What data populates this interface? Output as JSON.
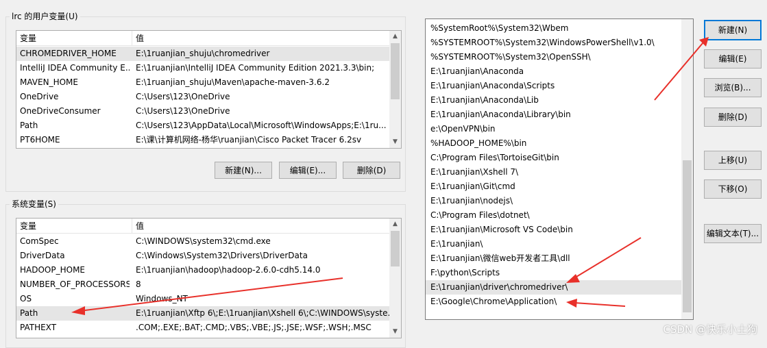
{
  "user_vars": {
    "title": "lrc 的用户变量(U)",
    "columns": [
      "变量",
      "值"
    ],
    "rows": [
      {
        "name": "CHROMEDRIVER_HOME",
        "value": "E:\\1ruanjian_shuju\\chromedriver"
      },
      {
        "name": "IntelliJ IDEA Community E...",
        "value": "E:\\1ruanjian\\IntelliJ IDEA Community Edition 2021.3.3\\bin;"
      },
      {
        "name": "MAVEN_HOME",
        "value": "E:\\1ruanjian_shuju\\Maven\\apache-maven-3.6.2"
      },
      {
        "name": "OneDrive",
        "value": "C:\\Users\\123\\OneDrive"
      },
      {
        "name": "OneDriveConsumer",
        "value": "C:\\Users\\123\\OneDrive"
      },
      {
        "name": "Path",
        "value": "C:\\Users\\123\\AppData\\Local\\Microsoft\\WindowsApps;E:\\1ru..."
      },
      {
        "name": "PT6HOME",
        "value": "E:\\课\\计算机网络-杨华\\ruanjian\\Cisco Packet Tracer 6.2sv"
      }
    ],
    "buttons": {
      "new": "新建(N)...",
      "edit": "编辑(E)...",
      "delete": "删除(D)"
    }
  },
  "system_vars": {
    "title": "系统变量(S)",
    "columns": [
      "变量",
      "值"
    ],
    "rows": [
      {
        "name": "ComSpec",
        "value": "C:\\WINDOWS\\system32\\cmd.exe"
      },
      {
        "name": "DriverData",
        "value": "C:\\Windows\\System32\\Drivers\\DriverData"
      },
      {
        "name": "HADOOP_HOME",
        "value": "E:\\1ruanjian\\hadoop\\hadoop-2.6.0-cdh5.14.0"
      },
      {
        "name": "NUMBER_OF_PROCESSORS",
        "value": "8"
      },
      {
        "name": "OS",
        "value": "Windows_NT"
      },
      {
        "name": "Path",
        "value": "E:\\1ruanjian\\Xftp 6\\;E:\\1ruanjian\\Xshell 6\\;C:\\WINDOWS\\syste..."
      },
      {
        "name": "PATHEXT",
        "value": ".COM;.EXE;.BAT;.CMD;.VBS;.VBE;.JS;.JSE;.WSF;.WSH;.MSC"
      }
    ]
  },
  "path_editor": {
    "entries": [
      "%SystemRoot%\\System32\\Wbem",
      "%SYSTEMROOT%\\System32\\WindowsPowerShell\\v1.0\\",
      "%SYSTEMROOT%\\System32\\OpenSSH\\",
      "E:\\1ruanjian\\Anaconda",
      "E:\\1ruanjian\\Anaconda\\Scripts",
      "E:\\1ruanjian\\Anaconda\\Lib",
      "E:\\1ruanjian\\Anaconda\\Library\\bin",
      "e:\\OpenVPN\\bin",
      "%HADOOP_HOME%\\bin",
      "C:\\Program Files\\TortoiseGit\\bin",
      "E:\\1ruanjian\\Xshell 7\\",
      "E:\\1ruanjian\\Git\\cmd",
      "E:\\1ruanjian\\nodejs\\",
      "C:\\Program Files\\dotnet\\",
      "E:\\1ruanjian\\Microsoft VS Code\\bin",
      "E:\\1ruanjian\\",
      "E:\\1ruanjian\\微信web开发者工具\\dll",
      "F:\\python\\Scripts",
      "E:\\1ruanjian\\driver\\chromedriver\\",
      "E:\\Google\\Chrome\\Application\\"
    ],
    "buttons": {
      "new": "新建(N)",
      "edit": "编辑(E)",
      "browse": "浏览(B)...",
      "delete": "删除(D)",
      "up": "上移(U)",
      "down": "下移(O)",
      "edit_text": "编辑文本(T)..."
    }
  },
  "watermark": "CSDN @快乐小土狗",
  "colors": {
    "annotation_arrow": "#e8302a",
    "selection": "#e5e5e5"
  }
}
